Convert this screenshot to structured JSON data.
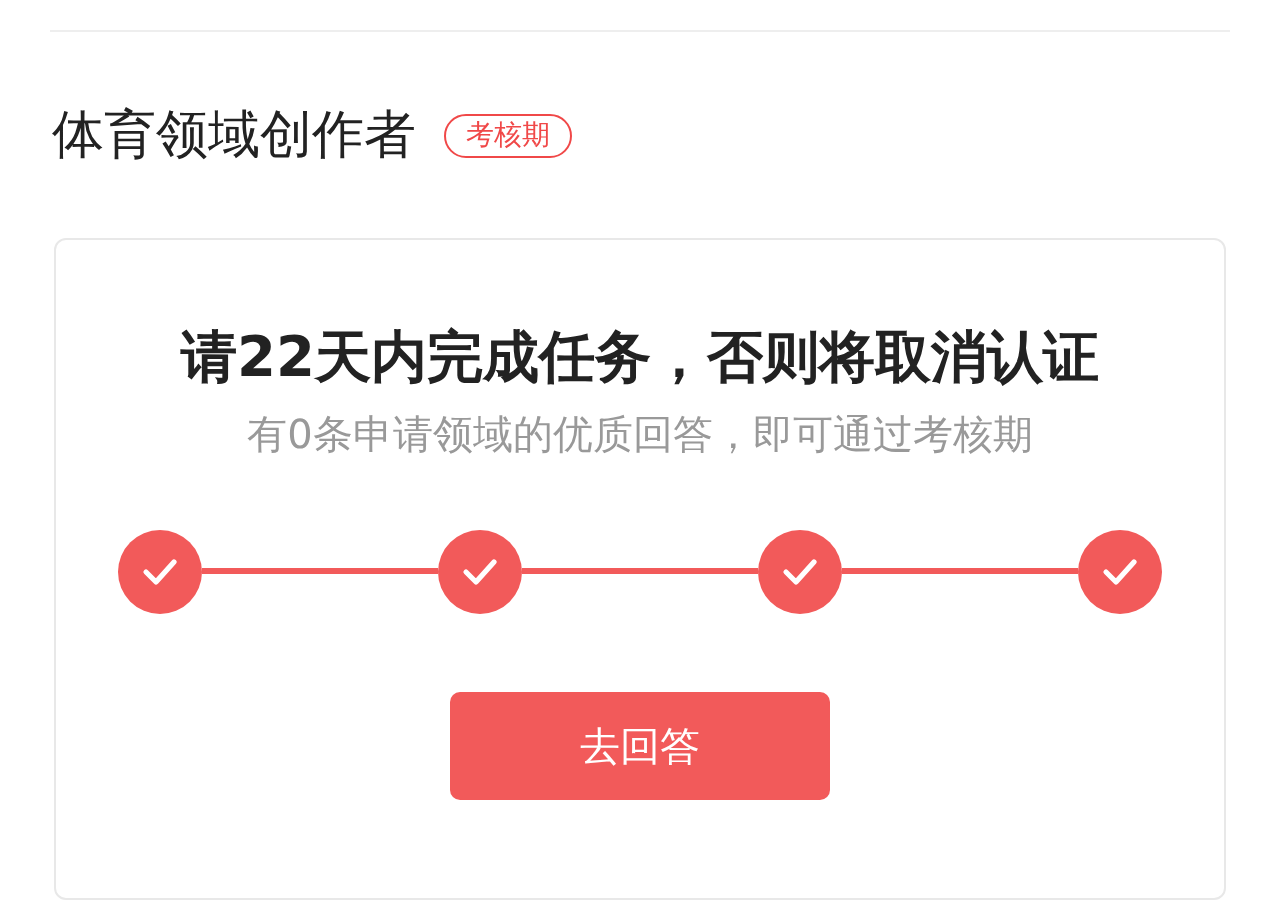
{
  "title": "体育领域创作者",
  "badge": "考核期",
  "card": {
    "heading": "请22天内完成任务，否则将取消认证",
    "subtitle": "有0条申请领域的优质回答，即可通过考核期",
    "steps": [
      {
        "done": true
      },
      {
        "done": true
      },
      {
        "done": true
      },
      {
        "done": true
      }
    ],
    "button": "去回答"
  }
}
